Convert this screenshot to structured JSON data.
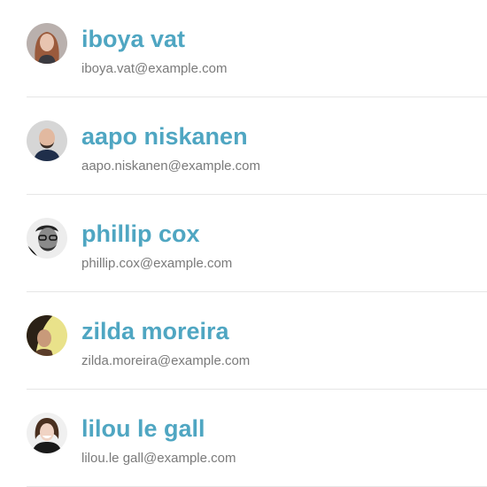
{
  "contacts": [
    {
      "name": "iboya vat",
      "email": "iboya.vat@example.com",
      "avatar": "woman-red-hair-avatar"
    },
    {
      "name": "aapo niskanen",
      "email": "aapo.niskanen@example.com",
      "avatar": "man-bald-beard-avatar"
    },
    {
      "name": "phillip cox",
      "email": "phillip.cox@example.com",
      "avatar": "man-glasses-bw-avatar"
    },
    {
      "name": "zilda moreira",
      "email": "zilda.moreira@example.com",
      "avatar": "woman-dark-hair-avatar"
    },
    {
      "name": "lilou le gall",
      "email": "lilou.le gall@example.com",
      "avatar": "woman-smiling-avatar"
    }
  ],
  "colors": {
    "name": "#4fa6c2",
    "email": "#7a7a7a",
    "divider": "#e6e6e6"
  }
}
